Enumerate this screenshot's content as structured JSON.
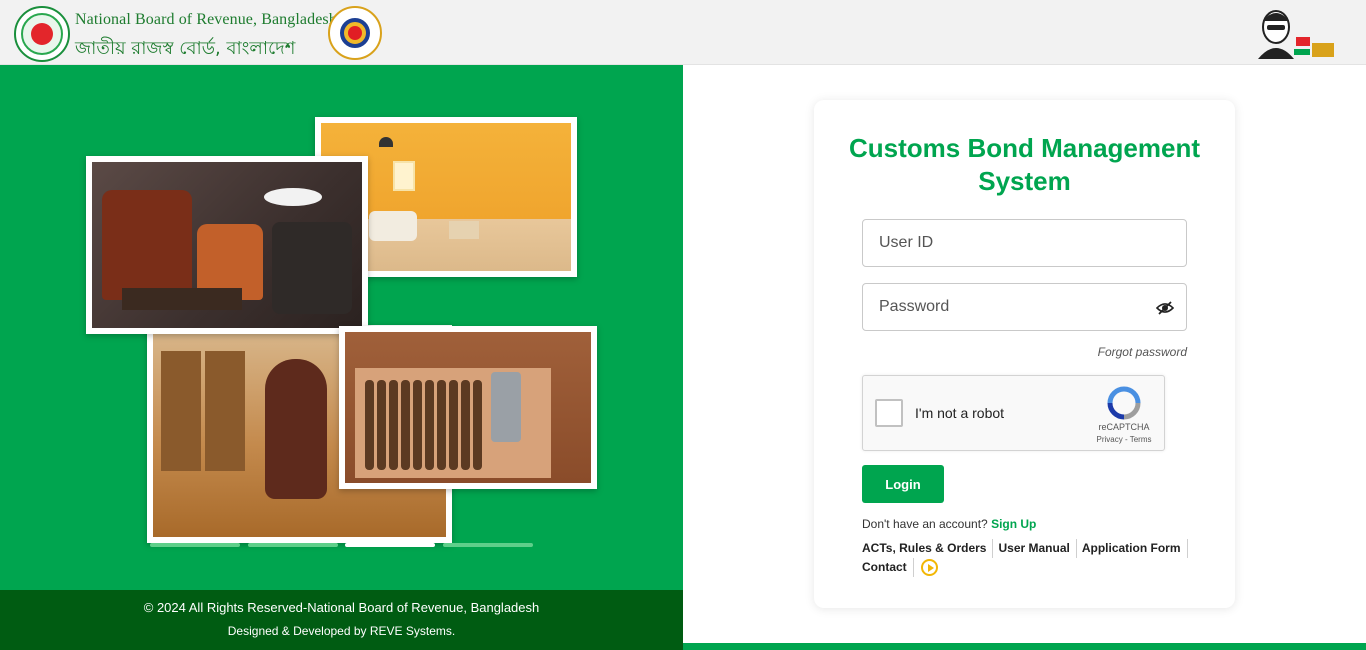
{
  "header": {
    "org_name_en": "National Board of Revenue, Bangladesh",
    "org_name_bn": "জাতীয় রাজস্ব বোর্ড, বাংলাদেশ"
  },
  "promo": {
    "carousel": {
      "slide_count": 4,
      "active_index": 2
    }
  },
  "footer": {
    "copyright": "© 2024 All Rights Reserved-National Board of Revenue, Bangladesh",
    "designed_by": "Designed & Developed by REVE Systems."
  },
  "login": {
    "title": "Customs Bond Management System",
    "user_id_placeholder": "User ID",
    "password_placeholder": "Password",
    "forgot_password": "Forgot password",
    "captcha_label": "I'm not a robot",
    "captcha_brand": "reCAPTCHA",
    "captcha_terms": "Privacy - Terms",
    "login_button": "Login",
    "no_account_text": "Don't have an account?",
    "signup_link": "Sign Up",
    "links": [
      "ACTs, Rules & Orders",
      "User Manual",
      "Application Form",
      "Contact"
    ]
  },
  "colors": {
    "brand_green": "#00a54f",
    "footer_dark_green": "#005c12",
    "header_bg": "#f2f2f2"
  },
  "icons": [
    "nbr-emblem-icon",
    "customs-emblem-icon",
    "mujib-100-icon",
    "eye-slash-icon",
    "recaptcha-icon",
    "play-icon"
  ]
}
